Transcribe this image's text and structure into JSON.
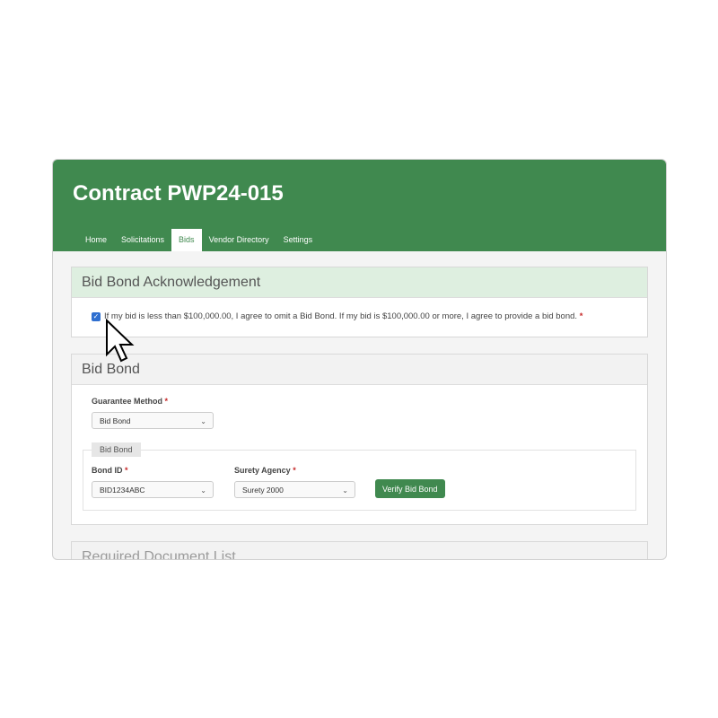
{
  "header": {
    "title": "Contract PWP24-015",
    "tabs": [
      {
        "label": "Home"
      },
      {
        "label": "Solicitations"
      },
      {
        "label": "Bids"
      },
      {
        "label": "Vendor Directory"
      },
      {
        "label": "Settings"
      }
    ],
    "active_tab": "Bids"
  },
  "acknowledgement": {
    "heading": "Bid Bond Acknowledgement",
    "checked": true,
    "text": "If my bid is less than $100,000.00, I agree to omit a Bid Bond. If my bid is $100,000.00 or more, I agree to provide a bid bond.",
    "required_mark": "*"
  },
  "bid_bond": {
    "heading": "Bid Bond",
    "guarantee_method": {
      "label": "Guarantee Method",
      "required_mark": "*",
      "value": "Bid Bond"
    },
    "group_legend": "Bid Bond",
    "bond_id": {
      "label": "Bond ID",
      "required_mark": "*",
      "value": "BID1234ABC"
    },
    "surety_agency": {
      "label": "Surety Agency",
      "required_mark": "*",
      "value": "Surety 2000"
    },
    "verify_button": "Verify Bid Bond"
  },
  "next_section": {
    "heading": "Required Document List"
  },
  "colors": {
    "brand_green": "#40894f",
    "checkbox_blue": "#2f6fd0",
    "required_red": "#c62828"
  },
  "icons": {
    "select_chevron": "chevron-down-icon",
    "checkbox_check": "check-icon",
    "pointer": "mouse-cursor-icon"
  }
}
